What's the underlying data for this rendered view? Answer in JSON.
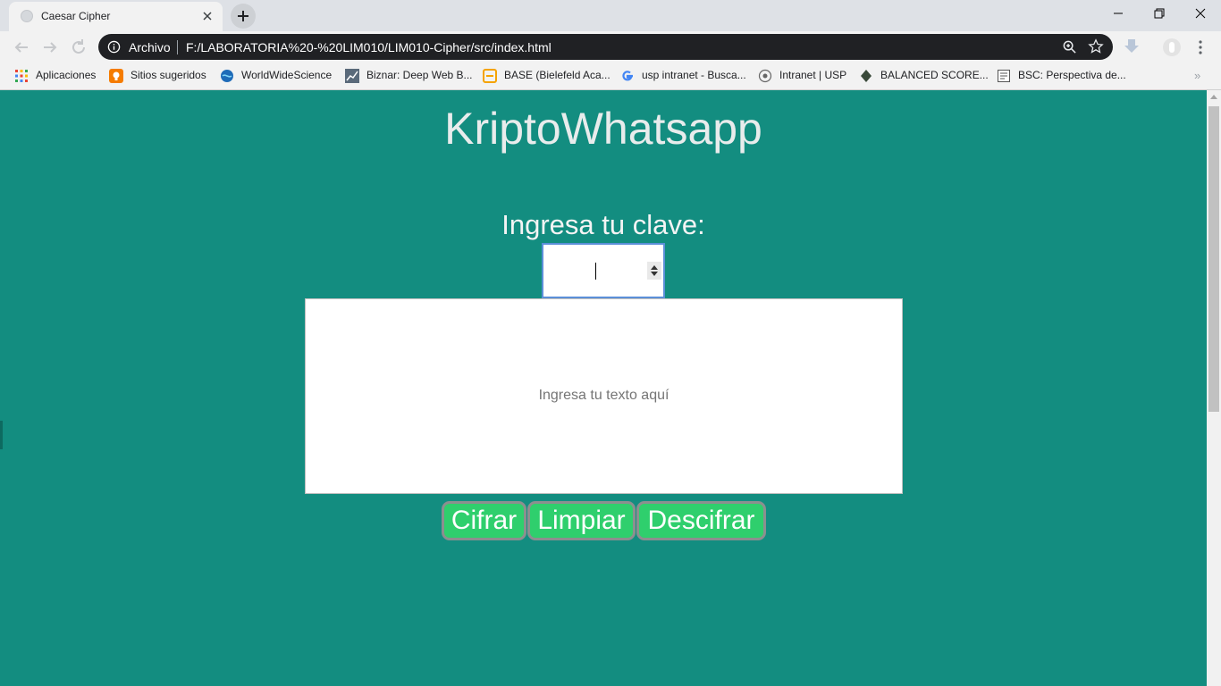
{
  "browser": {
    "tab_title": "Caesar Cipher",
    "omnibox_label": "Archivo",
    "url": "F:/LABORATORIA%20-%20LIM010/LIM010-Cipher/src/index.html",
    "bookmarks": [
      {
        "label": "Aplicaciones",
        "icon": "apps-grid-icon"
      },
      {
        "label": "Sitios sugeridos",
        "icon": "suggested-sites-icon"
      },
      {
        "label": "WorldWideScience",
        "icon": "globe-icon"
      },
      {
        "label": "Biznar: Deep Web B...",
        "icon": "chart-icon"
      },
      {
        "label": "BASE (Bielefeld Aca...",
        "icon": "base-icon"
      },
      {
        "label": "usp intranet - Busca...",
        "icon": "google-icon"
      },
      {
        "label": "Intranet | USP",
        "icon": "intranet-icon"
      },
      {
        "label": "BALANCED SCORE...",
        "icon": "diamond-icon"
      },
      {
        "label": "BSC: Perspectiva de...",
        "icon": "document-icon"
      }
    ],
    "bookmarks_more": "»"
  },
  "app": {
    "title": "KriptoWhatsapp",
    "key_label": "Ingresa tu clave:",
    "text_placeholder": "Ingresa tu texto aquí",
    "buttons": {
      "cipher": "Cifrar",
      "clear": "Limpiar",
      "decipher": "Descifrar"
    }
  },
  "colors": {
    "page_background": "#138d80",
    "button_background": "#2fcf6d",
    "button_border": "#8c8f8f"
  }
}
